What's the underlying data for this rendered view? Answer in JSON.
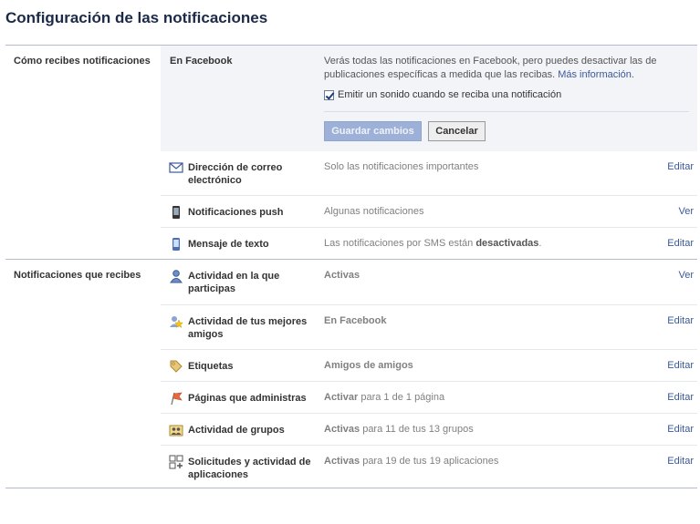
{
  "page": {
    "title": "Configuración de las notificaciones"
  },
  "how": {
    "section_label": "Cómo recibes notificaciones",
    "facebook": {
      "heading": "En Facebook",
      "description": "Verás todas las notificaciones en Facebook, pero puedes desactivar las de publicaciones específicas a medida que las recibas.",
      "more_info_link": "Más información",
      "period": ".",
      "sound_checkbox_label": "Emitir un sonido cuando se reciba una notificación",
      "sound_checked": true,
      "save_button": "Guardar cambios",
      "cancel_button": "Cancelar"
    },
    "rows": [
      {
        "icon": "envelope-icon",
        "name": "Dirección de correo electrónico",
        "status": "Solo las notificaciones importantes",
        "action": "Editar"
      },
      {
        "icon": "mobile-phone-icon",
        "name": "Notificaciones push",
        "status": "Algunas notificaciones",
        "action": "Ver"
      },
      {
        "icon": "sms-phone-icon",
        "name": "Mensaje de texto",
        "status_prefix": "Las notificaciones por SMS están ",
        "status_bold": "desactivadas",
        "status_suffix": ".",
        "action": "Editar"
      }
    ]
  },
  "what": {
    "section_label": "Notificaciones que recibes",
    "rows": [
      {
        "icon": "person-icon",
        "name": "Actividad en la que participas",
        "status_bold": "Activas",
        "status_rest": "",
        "action": "Ver"
      },
      {
        "icon": "star-friend-icon",
        "name": "Actividad de tus mejores amigos",
        "status_bold": "En Facebook",
        "status_rest": "",
        "action": "Editar"
      },
      {
        "icon": "tag-icon",
        "name": "Etiquetas",
        "status_bold": "Amigos de amigos",
        "status_rest": "",
        "action": "Editar"
      },
      {
        "icon": "flag-icon",
        "name": "Páginas que administras",
        "status_bold": "Activar",
        "status_rest": " para 1 de 1 página",
        "action": "Editar"
      },
      {
        "icon": "group-icon",
        "name": "Actividad de grupos",
        "status_bold": "Activas",
        "status_rest": " para 11 de tus 13 grupos",
        "action": "Editar"
      },
      {
        "icon": "apps-icon",
        "name": "Solicitudes y actividad de aplicaciones",
        "status_bold": "Activas",
        "status_rest": " para 19 de tus 19 aplicaciones",
        "action": "Editar"
      }
    ]
  },
  "colors": {
    "link": "#3b5998",
    "title": "#1c2a47",
    "panel": "#f2f4f8",
    "save_button": "#9db1d8"
  }
}
